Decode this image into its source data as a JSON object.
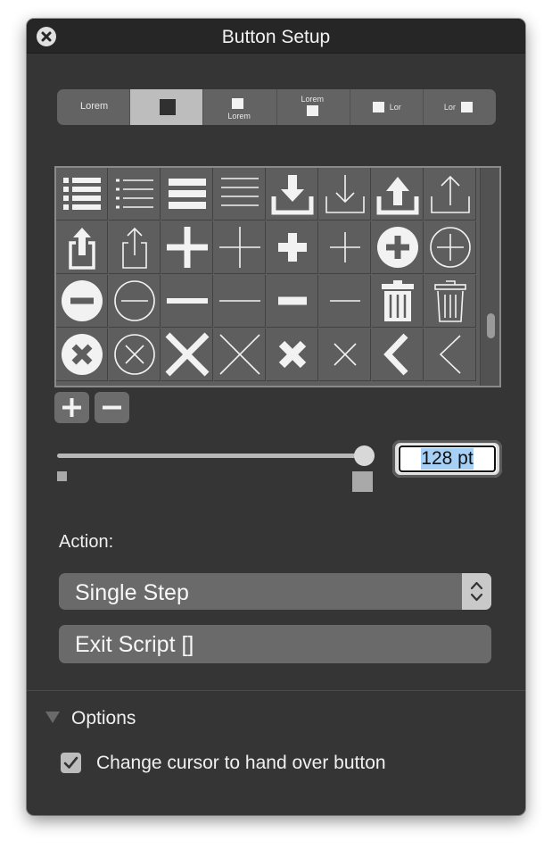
{
  "window": {
    "title": "Button Setup"
  },
  "segments": [
    {
      "name": "label-only",
      "label": "Lorem"
    },
    {
      "name": "icon-only",
      "label": ""
    },
    {
      "name": "icon-above-label",
      "label": "Lorem"
    },
    {
      "name": "label-above-icon",
      "label": "Lorem"
    },
    {
      "name": "icon-left-label",
      "label": "Lor"
    },
    {
      "name": "label-left-icon",
      "label": "Lor"
    }
  ],
  "segment_selected": "icon-only",
  "icon_grid": {
    "rows": [
      [
        "list-bold-icon",
        "list-thin-icon",
        "lines-bold-icon",
        "lines-thin-icon",
        "download-bold-icon",
        "download-thin-icon",
        "upload-bold-icon",
        "upload-thin-icon"
      ],
      [
        "share-bold-icon",
        "share-thin-icon",
        "plus-bold-icon",
        "plus-thin-icon",
        "plus-small-bold-icon",
        "plus-small-thin-icon",
        "plus-circle-bold-icon",
        "plus-circle-thin-icon"
      ],
      [
        "minus-circle-bold-icon",
        "minus-circle-thin-icon",
        "minus-bold-icon",
        "minus-thin-icon",
        "minus-small-bold-icon",
        "minus-small-thin-icon",
        "trash-bold-icon",
        "trash-thin-icon"
      ],
      [
        "close-circle-bold-icon",
        "close-circle-thin-icon",
        "x-bold-icon",
        "x-thin-icon",
        "x-small-bold-icon",
        "x-small-thin-icon",
        "chevron-left-bold-icon",
        "chevron-left-thin-icon"
      ]
    ]
  },
  "size": {
    "value": "128 pt",
    "fraction": 1.0
  },
  "action": {
    "label": "Action:",
    "selected": "Single Step",
    "script": "Exit Script []"
  },
  "options": {
    "title": "Options",
    "cursor_label": "Change cursor to hand over button",
    "cursor_checked": true
  }
}
